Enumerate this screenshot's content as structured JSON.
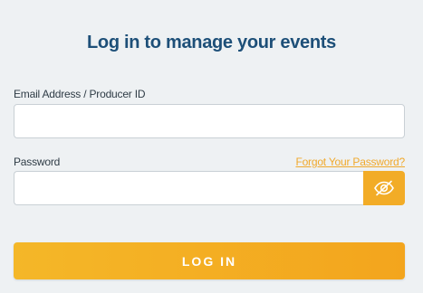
{
  "form": {
    "title": "Log in to manage your events",
    "email_label": "Email Address / Producer ID",
    "email_value": "",
    "password_label": "Password",
    "password_value": "",
    "forgot_link": "Forgot Your Password?",
    "login_button": "LOG IN",
    "toggle_icon": "eye-off-icon"
  },
  "colors": {
    "background": "#eef1f3",
    "title": "#1d4f78",
    "accent": "#f2ac27",
    "link": "#f0a92c"
  }
}
